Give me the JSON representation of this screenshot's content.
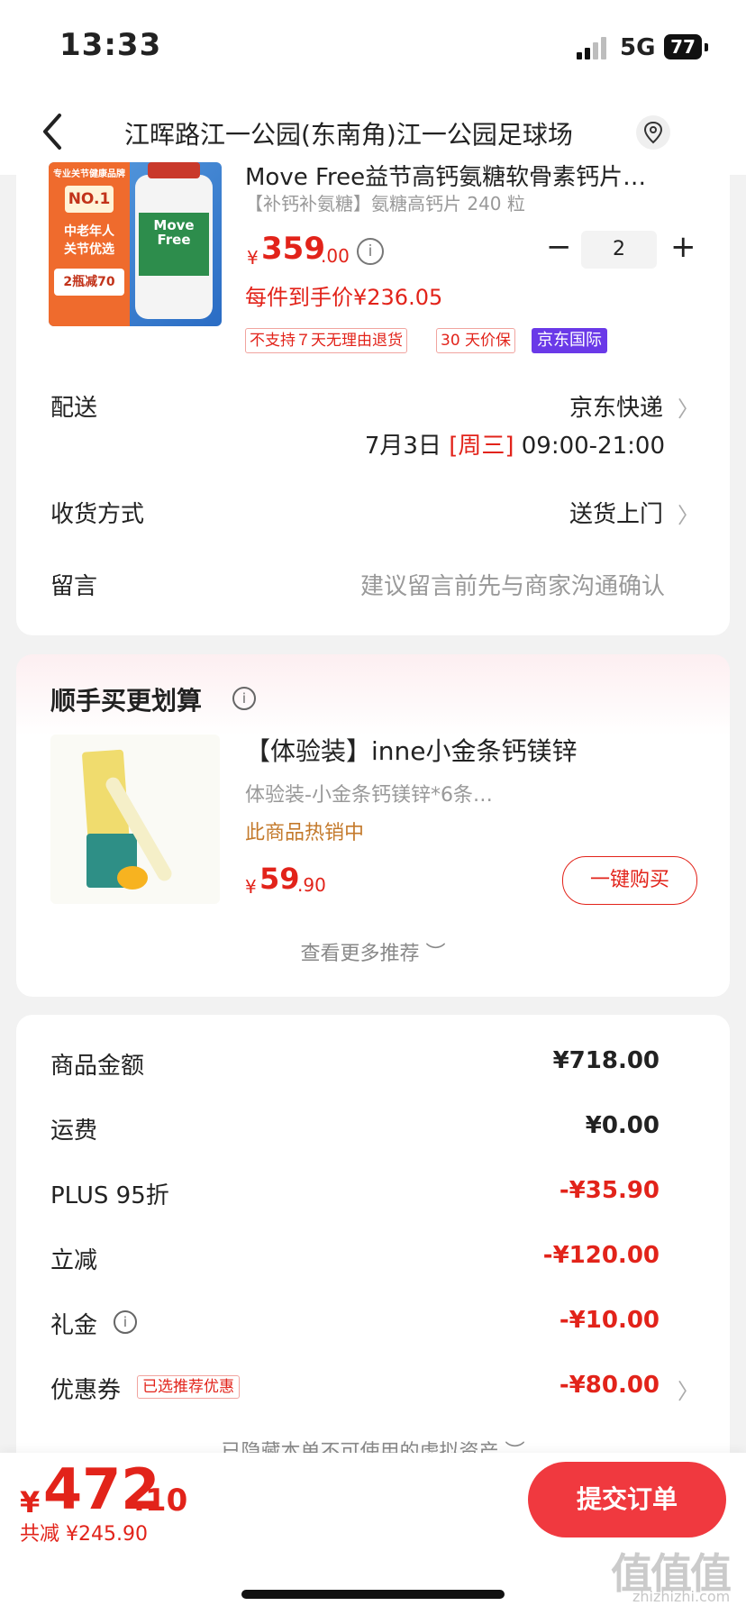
{
  "status_bar": {
    "time": "13:33",
    "network": "5G",
    "battery": "77"
  },
  "nav": {
    "title": "江晖路江一公园(东南角)江一公园足球场"
  },
  "product": {
    "title": "Move Free益节高钙氨糖软骨素钙片…",
    "spec": "【补钙补氨糖】氨糖高钙片 240 粒",
    "price_yen": "¥",
    "price_int": "359",
    "price_dec": ".00",
    "quantity": "2",
    "each_price": "每件到手价¥236.05",
    "tags": [
      "不支持７天无理由退货",
      "30 天价保"
    ],
    "jd_tag": "京东国际",
    "image": {
      "badge_top": "专业关节健康品牌",
      "badge_no1": "NO.1",
      "badge_mid1": "中老年人",
      "badge_mid2": "关节优选",
      "badge_deal": "2瓶减70",
      "bottle_brand": "Move Free"
    }
  },
  "delivery": {
    "label": "配送",
    "carrier": "京东快递",
    "date": "7月3日",
    "weekday": "[周三]",
    "window": "09:00-21:00"
  },
  "receive": {
    "label": "收货方式",
    "value": "送货上门"
  },
  "message": {
    "label": "留言",
    "placeholder": "建议留言前先与商家沟通确认"
  },
  "recommend": {
    "title": "顺手买更划算",
    "item_name": "【体验装】inne小金条钙镁锌",
    "item_sub": "体验装-小金条钙镁锌*6条…",
    "hot": "此商品热销中",
    "price_yen": "¥",
    "price_int": "59",
    "price_dec": ".90",
    "buy_label": "一键购买",
    "more_label": "查看更多推荐 ︶"
  },
  "summary": {
    "rows": [
      {
        "label": "商品金额",
        "value": "¥718.00"
      },
      {
        "label": "运费",
        "value": "¥0.00"
      },
      {
        "label": "PLUS 95折",
        "value": "-¥35.90"
      },
      {
        "label": "立减",
        "value": "-¥120.00"
      },
      {
        "label": "礼金",
        "value": "-¥10.00"
      },
      {
        "label": "优惠券",
        "value": "-¥80.00"
      }
    ],
    "coupon_tag": "已选推荐优惠",
    "hidden_assets": "已隐藏本单不可使用的虚拟资产 ︶"
  },
  "footer": {
    "total_yen": "¥",
    "total_int": "472",
    "total_dec": ".10",
    "saved": "共减 ¥245.90",
    "submit_label": "提交订单"
  },
  "watermark": {
    "text": "值值值",
    "url": "zhizhizhi.com"
  },
  "colors": {
    "accent_red": "#e2231a",
    "button_red": "#f0393f",
    "jd_purple": "#6a39e8"
  }
}
